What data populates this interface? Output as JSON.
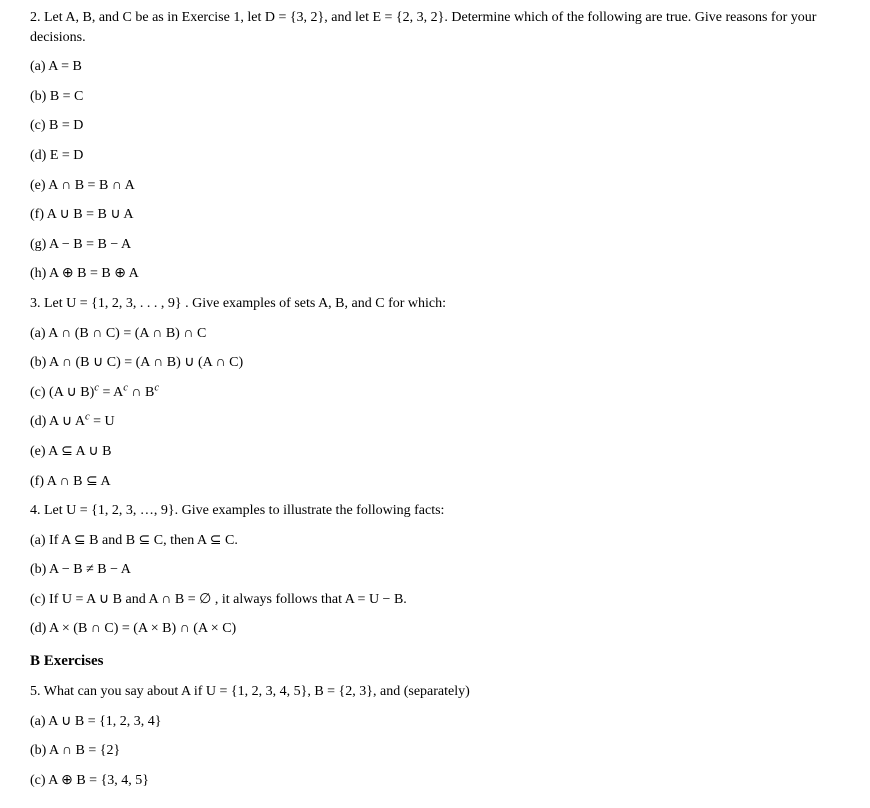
{
  "q2": {
    "intro": "2.   Let A, B, and C be as in Exercise 1, let D  =  {3,  2}, and let E  =  {2,  3,  2}. Determine which of the following are true. Give reasons for your decisions.",
    "a": "(a)   A  =  B",
    "b": "(b)   B  =  C",
    "c": "(c)  B  =  D",
    "d": "(d)  E = D",
    "e": "(e)  A ∩ B  =  B ∩ A",
    "f": " (f) A  ∪  B  =  B  ∪  A",
    "g": "(g) A  −  B  =  B − A",
    "h": " (h) A  ⊕  B  =  B ⊕ A"
  },
  "q3": {
    "intro": "3.   Let U = {1, 2, 3, . . . , 9} .  Give examples of sets A, B, and C for which:",
    "a": "(a)  A ∩ (B ∩ C) = (A ∩ B) ∩ C",
    "b": "(b)  A ∩ (B ∪ C) = (A ∩ B) ∪ (A ∩ C)",
    "c_pre": "(c)  (A  ∪  B)",
    "c_mid": "  =  A",
    "c_mid2": "  ∩  B",
    "d_pre": "(d)  A  ∪  A",
    "d_post": "   =  U",
    "e": "(e)  A  ⊆ A ∪ B",
    "f": "(f)  A ∩ B  ⊆  A"
  },
  "q4": {
    "intro": "4.  Let U =  {1,  2,  3,  …,  9}. Give examples to illustrate the following facts:",
    "a": "(a)  If A  ⊆  B and B  ⊆ C, then A ⊆ C.",
    "b": "(b)   A   −   B  ≠  B   −   A",
    "c": "(c)  If U  =  A ∪  B and A ∩ B =  ∅ , it always follows that A  =  U  −  B.",
    "d": "(d)  A × (B ∩ C)  =  (A × B) ∩  (A  × C)"
  },
  "sectionB": "B Exercises",
  "q5": {
    "intro": "5.   What can you say about A if U  =  {1,  2,  3,  4,  5}, B  =  {2,  3}, and (separately)",
    "a": "(a)  A  ∪ B  =  {1,  2,  3, 4}",
    "b": "(b)  A  ∩  B  =  {2}",
    "c": "(c)  A  ⊕  B  =  {3,  4,  5}"
  },
  "sup_c": "c"
}
